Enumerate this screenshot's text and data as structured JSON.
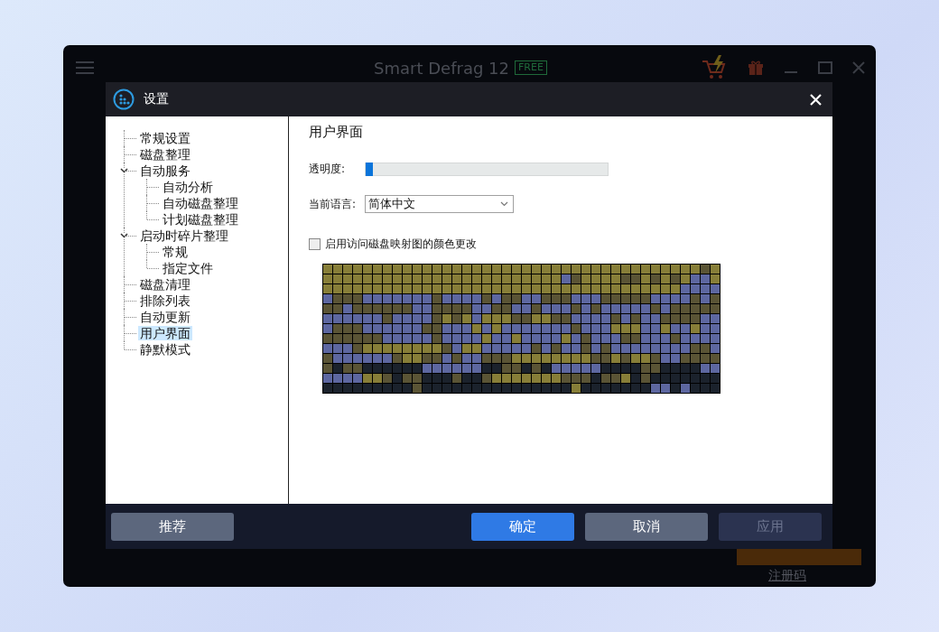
{
  "app_window": {
    "title": "Smart Defrag 12",
    "badge": "FREE",
    "register_link": "注册码"
  },
  "dialog": {
    "title": "设置"
  },
  "tree": [
    {
      "label": "常规设置",
      "selected": false
    },
    {
      "label": "磁盘整理",
      "selected": false
    },
    {
      "label": "自动服务",
      "selected": false,
      "expanded": true,
      "children": [
        {
          "label": "自动分析",
          "selected": false
        },
        {
          "label": "自动磁盘整理",
          "selected": false
        },
        {
          "label": "计划磁盘整理",
          "selected": false
        }
      ]
    },
    {
      "label": "启动时碎片整理",
      "selected": false,
      "expanded": true,
      "children": [
        {
          "label": "常规",
          "selected": false
        },
        {
          "label": "指定文件",
          "selected": false
        }
      ]
    },
    {
      "label": "磁盘清理",
      "selected": false
    },
    {
      "label": "排除列表",
      "selected": false
    },
    {
      "label": "自动更新",
      "selected": false
    },
    {
      "label": "用户界面",
      "selected": true
    },
    {
      "label": "静默模式",
      "selected": false
    }
  ],
  "panel": {
    "heading": "用户界面",
    "transparency": {
      "label": "透明度:",
      "level": 0.0
    },
    "language": {
      "label": "当前语言:",
      "value": "简体中文"
    },
    "color_option": {
      "label": "启用访问磁盘映射图的颜色更改",
      "checked": false
    }
  },
  "buttons": [
    {
      "label": "推荐",
      "kind": "secondary"
    },
    {
      "label": "确定",
      "kind": "primary"
    },
    {
      "label": "取消",
      "kind": "secondary"
    },
    {
      "label": "应用",
      "kind": "disabled"
    }
  ]
}
